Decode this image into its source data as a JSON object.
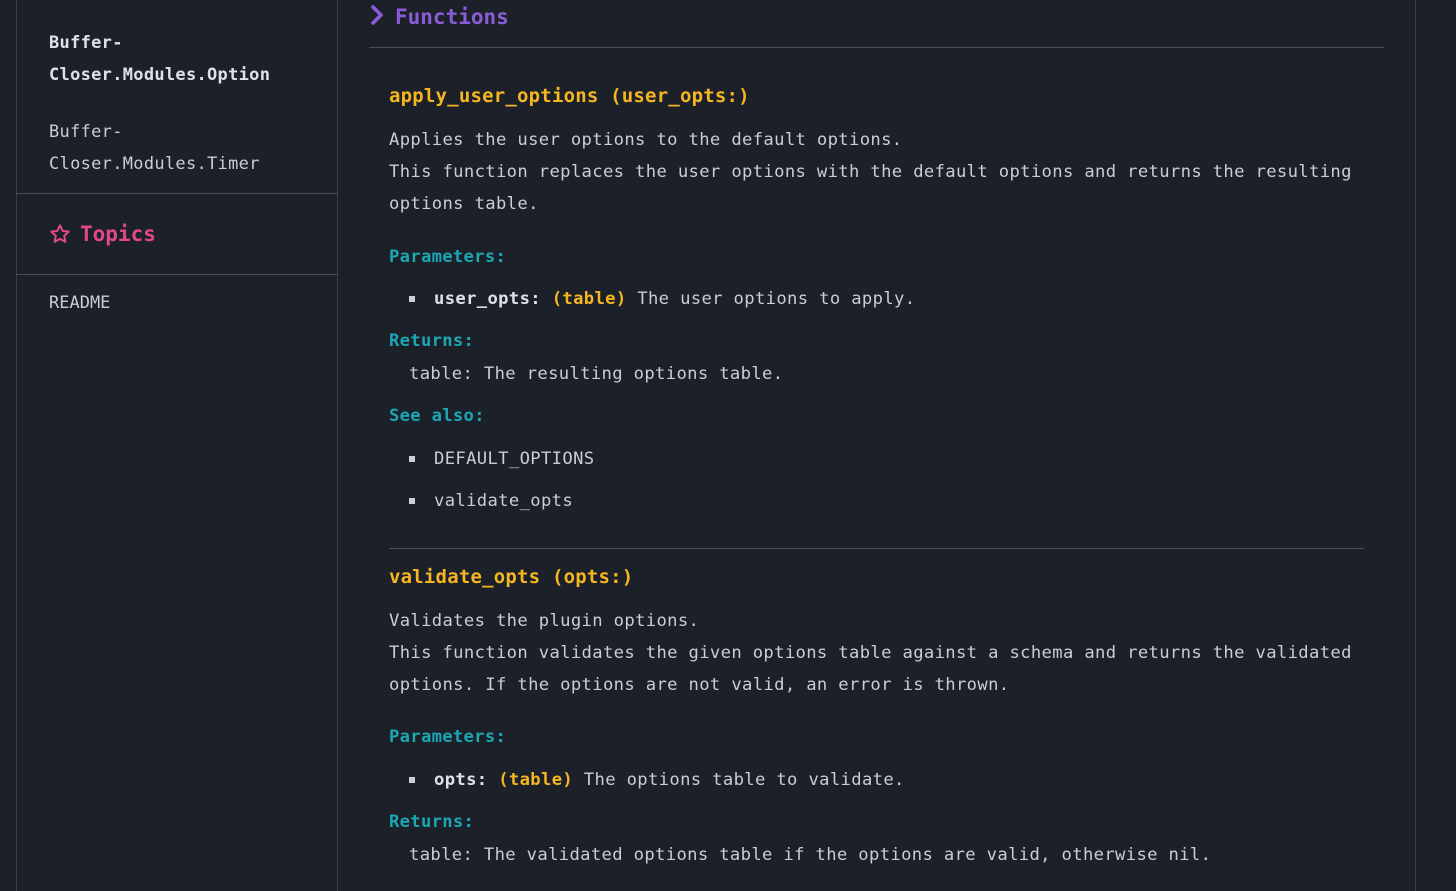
{
  "sidebar": {
    "modules": [
      {
        "line1": "Buffer-",
        "line2": "Closer.Modules.Option",
        "active": true
      },
      {
        "line1": "Buffer-",
        "line2": "Closer.Modules.Timer",
        "active": false
      }
    ],
    "topics_heading": "Topics",
    "topics": [
      "README"
    ]
  },
  "main": {
    "section_title": "Functions",
    "functions": [
      {
        "title": "apply_user_options (user_opts:)",
        "summary": "Applies the user options to the default options.",
        "description_line1": "This function replaces the user options with the default options and returns the resulting",
        "description_line2": "options table.",
        "parameters_label": "Parameters:",
        "params": [
          {
            "name": "user_opts",
            "sep": ":",
            "type": "(table)",
            "desc": "The user options to apply."
          }
        ],
        "returns_label": "Returns:",
        "returns": "table: The resulting options table.",
        "see_also_label": "See also:",
        "see_also": [
          "DEFAULT_OPTIONS",
          "validate_opts"
        ]
      },
      {
        "title": "validate_opts (opts:)",
        "summary": "Validates the plugin options.",
        "description_line1": "This function validates the given options table against a schema and returns the validated",
        "description_line2": "options. If the options are not valid, an error is thrown.",
        "parameters_label": "Parameters:",
        "params": [
          {
            "name": "opts",
            "sep": ":",
            "type": "(table)",
            "desc": "The options table to validate."
          }
        ],
        "returns_label": "Returns:",
        "returns": "table: The validated options table if the options are valid, otherwise nil."
      }
    ]
  },
  "colors": {
    "background": "#1c2028",
    "section_heading": "#8a5cd8",
    "topics_heading": "#e2478a",
    "function_title": "#f5b621",
    "label": "#1ba7b3"
  },
  "icons": {
    "section": "chevron-right-icon",
    "topics": "star-outline-icon",
    "bullet": "square-bullet-icon"
  }
}
